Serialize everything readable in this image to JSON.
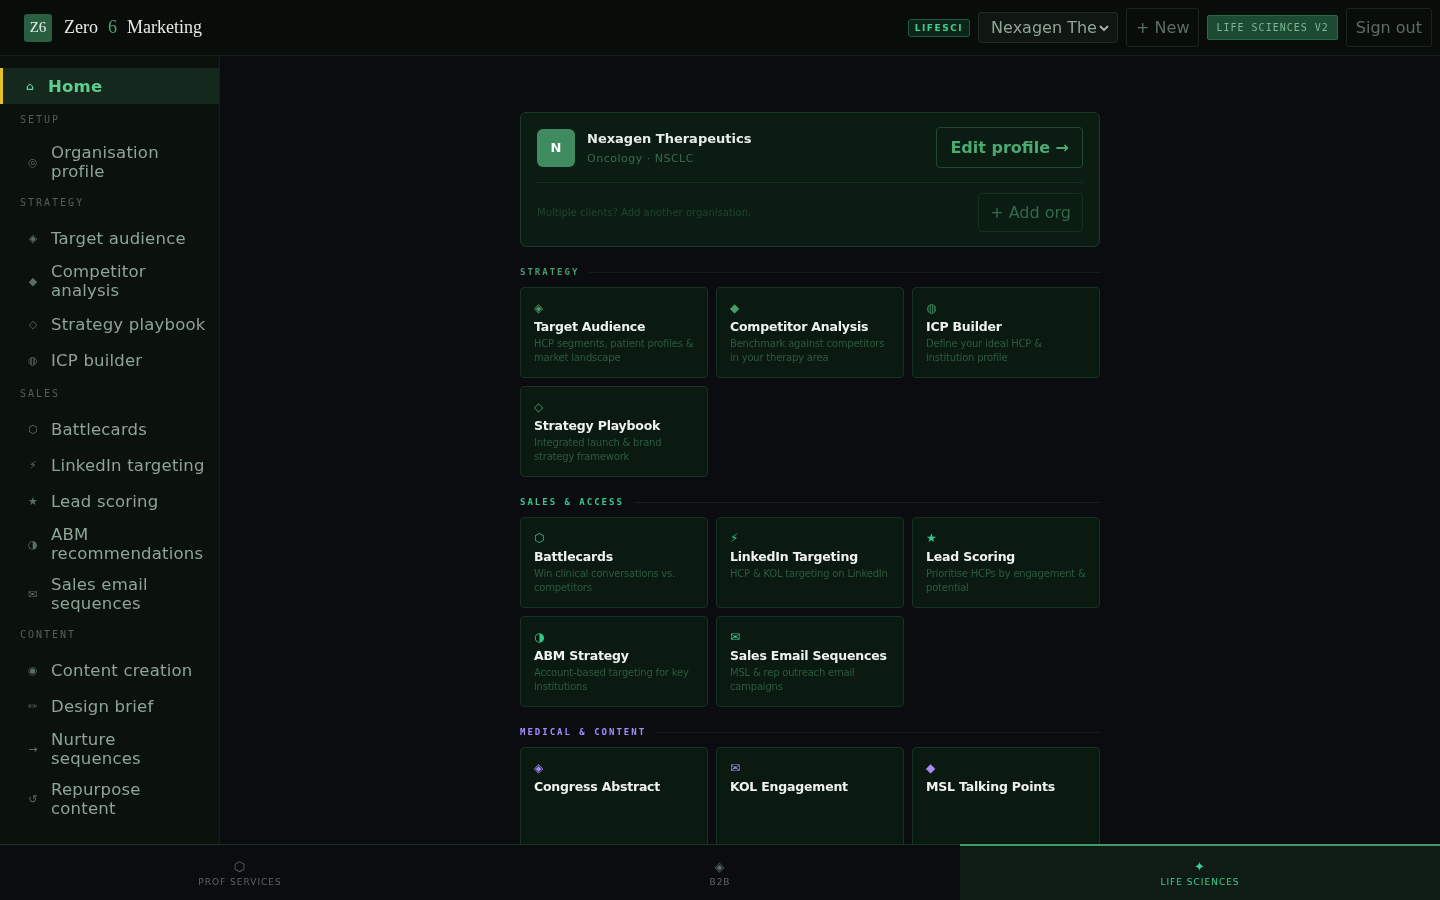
{
  "header": {
    "logo": "Z6",
    "brand": [
      "Zero",
      "6",
      "Marketing"
    ],
    "badge": "LIFESCI",
    "org_select": "Nexagen The",
    "new_button": "+ New",
    "version_badge": "LIFE SCIENCES V2",
    "sign_out": "Sign out"
  },
  "sidebar": {
    "home": {
      "icon": "⌂",
      "label": "Home",
      "selected": true
    },
    "sections": [
      {
        "title": "SETUP",
        "items": [
          {
            "icon": "◎",
            "label": "Organisation profile",
            "selected": false
          }
        ]
      },
      {
        "title": "STRATEGY",
        "items": [
          {
            "icon": "◈",
            "label": "Target audience",
            "selected": false
          },
          {
            "icon": "◆",
            "label": "Competitor analysis",
            "selected": false
          },
          {
            "icon": "◇",
            "label": "Strategy playbook",
            "selected": false
          },
          {
            "icon": "◍",
            "label": "ICP builder",
            "selected": false
          }
        ]
      },
      {
        "title": "SALES",
        "items": [
          {
            "icon": "⬡",
            "label": "Battlecards",
            "selected": false
          },
          {
            "icon": "⚡",
            "label": "LinkedIn targeting",
            "selected": false
          },
          {
            "icon": "★",
            "label": "Lead scoring",
            "selected": false
          },
          {
            "icon": "◑",
            "label": "ABM recommendations",
            "selected": false
          },
          {
            "icon": "✉",
            "label": "Sales email sequences",
            "selected": false
          }
        ]
      },
      {
        "title": "CONTENT",
        "items": [
          {
            "icon": "◉",
            "label": "Content creation",
            "selected": false
          },
          {
            "icon": "✏",
            "label": "Design brief",
            "selected": false
          },
          {
            "icon": "→",
            "label": "Nurture sequences",
            "selected": false
          },
          {
            "icon": "↺",
            "label": "Repurpose content",
            "selected": false
          }
        ]
      }
    ]
  },
  "org_card": {
    "avatar": "N",
    "name": "Nexagen Therapeutics",
    "subtitle": "Oncology · NSCLC",
    "edit_button": "Edit profile →",
    "hint": "Multiple clients? Add another organisation.",
    "add_button": "+ Add org"
  },
  "sections": [
    {
      "title": "STRATEGY",
      "color": "#4a9a6a",
      "cards": [
        {
          "icon": "◈",
          "title": "Target Audience",
          "description": "HCP segments, patient profiles & market landscape"
        },
        {
          "icon": "◆",
          "title": "Competitor Analysis",
          "description": "Benchmark against competitors in your therapy area"
        },
        {
          "icon": "◍",
          "title": "ICP Builder",
          "description": "Define your ideal HCP & institution profile"
        },
        {
          "icon": "◇",
          "title": "Strategy Playbook",
          "description": "Integrated launch & brand strategy framework"
        }
      ]
    },
    {
      "title": "SALES & ACCESS",
      "color": "#34c88a",
      "cards": [
        {
          "icon": "⬡",
          "title": "Battlecards",
          "description": "Win clinical conversations vs. competitors"
        },
        {
          "icon": "⚡",
          "title": "LinkedIn Targeting",
          "description": "HCP & KOL targeting on LinkedIn"
        },
        {
          "icon": "★",
          "title": "Lead Scoring",
          "description": "Prioritise HCPs by engagement & potential"
        },
        {
          "icon": "◑",
          "title": "ABM Strategy",
          "description": "Account-based targeting for key institutions"
        },
        {
          "icon": "✉",
          "title": "Sales Email Sequences",
          "description": "MSL & rep outreach email campaigns"
        }
      ]
    },
    {
      "title": "MEDICAL & CONTENT",
      "color": "#a78bfa",
      "cards": [
        {
          "icon": "◈",
          "title": "Congress Abstract"
        },
        {
          "icon": "✉",
          "title": "KOL Engagement"
        },
        {
          "icon": "◆",
          "title": "MSL Talking Points"
        }
      ]
    }
  ],
  "bottom_tabs": [
    {
      "icon": "⬡",
      "label": "PROF SERVICES",
      "selected": false
    },
    {
      "icon": "◈",
      "label": "B2B",
      "selected": false
    },
    {
      "icon": "✦",
      "label": "LIFE SCIENCES",
      "selected": true
    }
  ]
}
